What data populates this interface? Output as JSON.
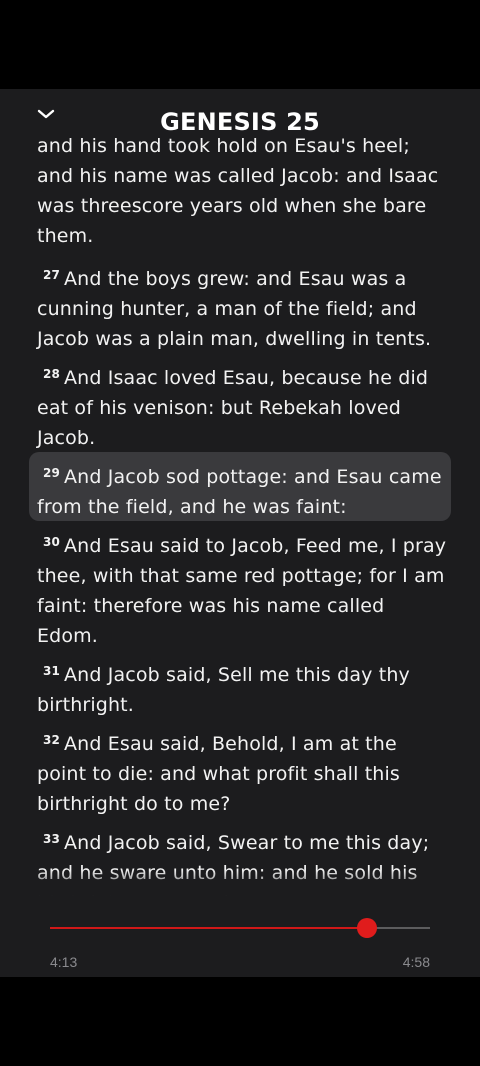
{
  "header": {
    "title": "GENESIS 25",
    "collapse_icon": "chevron-down-icon"
  },
  "verses": [
    {
      "num": "",
      "text": "and his hand took hold on Esau's heel; and his name was called Jacob: and Isaac was threescore years old when she bare them."
    },
    {
      "num": "27",
      "text": "And the boys grew: and Esau was a cunning hunter, a man of the field; and Jacob was a plain man, dwelling in tents."
    },
    {
      "num": "28",
      "text": "And Isaac loved Esau, because he did eat of his venison: but Rebekah loved Jacob."
    },
    {
      "num": "29",
      "text": "And Jacob sod pottage: and Esau came from the field, and he was faint:",
      "highlighted": true
    },
    {
      "num": "30",
      "text": "And Esau said to Jacob, Feed me, I pray thee, with that same red pottage; for I am faint: therefore was his name called Edom."
    },
    {
      "num": "31",
      "text": "And Jacob said, Sell me this day thy birthright."
    },
    {
      "num": "32",
      "text": "And Esau said, Behold, I am at the point to die: and what profit shall this birthright do to me?"
    },
    {
      "num": "33",
      "text": "And Jacob said, Swear to me this day; and he sware unto him: and he sold his birthright unto Jacob."
    }
  ],
  "player": {
    "elapsed": "4:13",
    "total": "4:58",
    "progress": 0.835,
    "accent_color": "#e01c1c"
  }
}
